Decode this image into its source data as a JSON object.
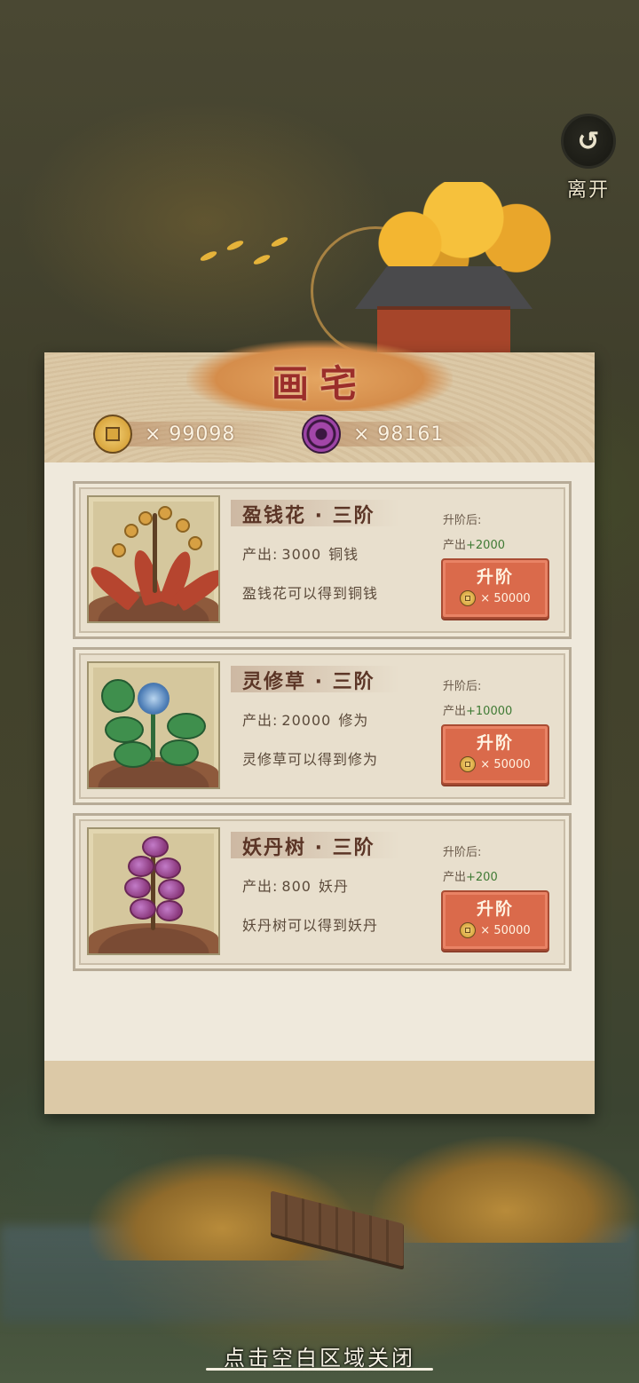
{
  "leave": {
    "label": "离开"
  },
  "panel": {
    "title": "画宅",
    "resources": [
      {
        "icon": "copper-coin-icon",
        "count": "× 99098"
      },
      {
        "icon": "purple-pill-icon",
        "count": "× 98161"
      }
    ]
  },
  "plants": [
    {
      "name": "盈钱花 · 三阶",
      "output_label": "产出:",
      "output_value": "3000",
      "output_unit": "铜钱",
      "description": "盈钱花可以得到铜钱",
      "after_label": "升阶后:",
      "after_prefix": "产出",
      "after_plus": "+2000",
      "button_label": "升阶",
      "cost": "× 50000",
      "icon": "money-flower-icon"
    },
    {
      "name": "灵修草 · 三阶",
      "output_label": "产出:",
      "output_value": "20000",
      "output_unit": "修为",
      "description": "灵修草可以得到修为",
      "after_label": "升阶后:",
      "after_prefix": "产出",
      "after_plus": "+10000",
      "button_label": "升阶",
      "cost": "× 50000",
      "icon": "spirit-grass-icon"
    },
    {
      "name": "妖丹树 · 三阶",
      "output_label": "产出:",
      "output_value": "800",
      "output_unit": "妖丹",
      "description": "妖丹树可以得到妖丹",
      "after_label": "升阶后:",
      "after_prefix": "产出",
      "after_plus": "+200",
      "button_label": "升阶",
      "cost": "× 50000",
      "icon": "demon-pill-tree-icon"
    }
  ],
  "hint": "点击空白区域关闭",
  "colors": {
    "accent": "#da6a4b",
    "title": "#9b2e2a",
    "panel": "#efe9dc",
    "header": "#dcc9a7",
    "positive": "#3f7a34"
  }
}
